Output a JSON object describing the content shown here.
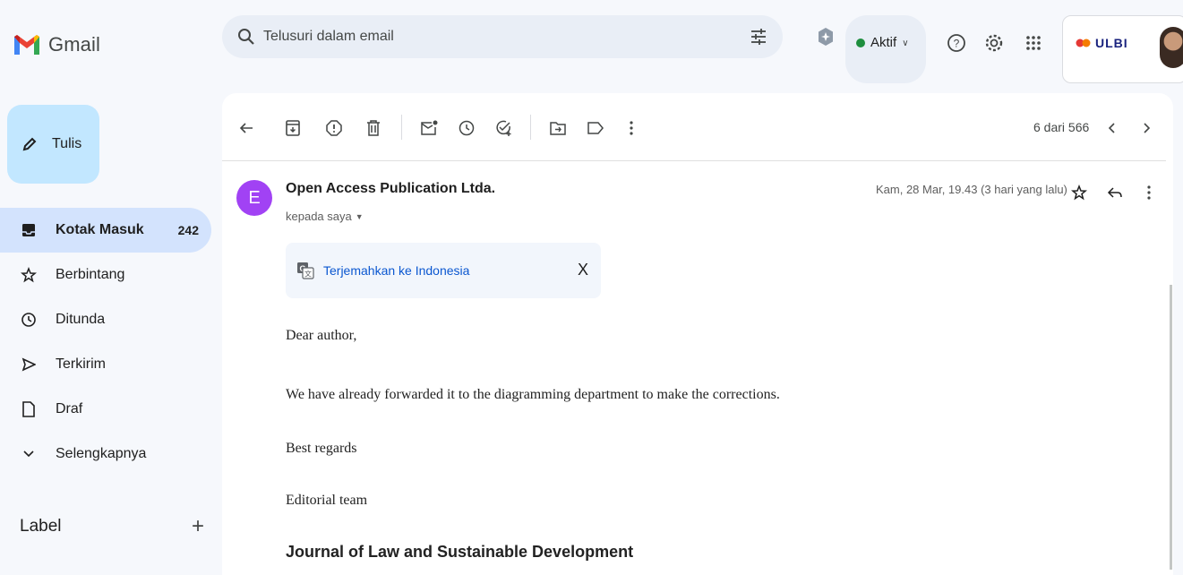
{
  "brand": {
    "name": "Gmail"
  },
  "search": {
    "placeholder": "Telusuri dalam email"
  },
  "status": {
    "label": "Aktif"
  },
  "account": {
    "logo_text": "ULBI"
  },
  "compose": {
    "label": "Tulis"
  },
  "sidebar": {
    "items": [
      {
        "label": "Kotak Masuk",
        "count": "242",
        "icon": "inbox-icon",
        "active": true
      },
      {
        "label": "Berbintang",
        "icon": "star-icon"
      },
      {
        "label": "Ditunda",
        "icon": "clock-icon"
      },
      {
        "label": "Terkirim",
        "icon": "send-icon"
      },
      {
        "label": "Draf",
        "icon": "draft-icon"
      },
      {
        "label": "Selengkapnya",
        "icon": "chevron-down-icon"
      }
    ],
    "labels_heading": "Label"
  },
  "toolbar": {
    "pager": "6 dari 566"
  },
  "email": {
    "sender_initial": "E",
    "sender_name": "Open Access Publication Ltda.",
    "recipient": "kepada saya",
    "date": "Kam, 28 Mar, 19.43 (3 hari yang lalu)",
    "translate_label": "Terjemahkan ke Indonesia",
    "translate_close": "X",
    "body": {
      "greeting": "Dear author,",
      "line1": "We have already forwarded it to the diagramming department to make the corrections.",
      "closing": "Best regards",
      "team": "Editorial team",
      "journal": "Journal of Law and Sustainable Development"
    }
  },
  "colors": {
    "compose_bg": "#c2e7ff",
    "active_nav_bg": "#d3e3fd",
    "avatar_bg": "#a142f4",
    "status_dot": "#1e8e3e",
    "link": "#0b57d0"
  }
}
